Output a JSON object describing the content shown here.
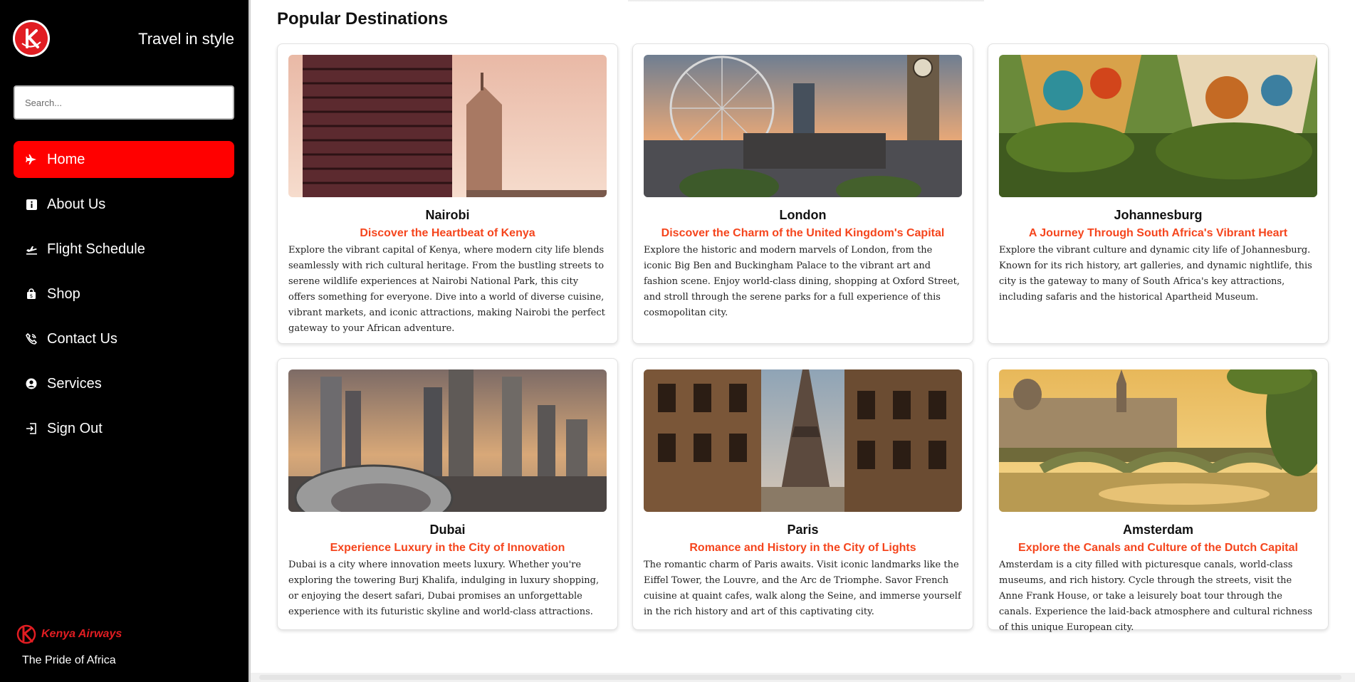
{
  "sidebar": {
    "tagline": "Travel in style",
    "search_placeholder": "Search...",
    "items": [
      {
        "label": "Home",
        "icon": "airplane-icon",
        "active": true
      },
      {
        "label": "About Us",
        "icon": "info-icon"
      },
      {
        "label": "Flight Schedule",
        "icon": "flight-departure-icon"
      },
      {
        "label": "Shop",
        "icon": "shopping-bag-icon"
      },
      {
        "label": "Contact Us",
        "icon": "phone-icon"
      },
      {
        "label": "Services",
        "icon": "user-circle-icon"
      },
      {
        "label": "Sign Out",
        "icon": "sign-out-icon"
      }
    ],
    "brand_name": "Kenya Airways",
    "motto": "The Pride of Africa"
  },
  "main": {
    "title": "Popular Destinations",
    "destinations": [
      {
        "city": "Nairobi",
        "subtitle": "Discover the Heartbeat of Kenya",
        "description": "Explore the vibrant capital of Kenya, where modern city life blends seamlessly with rich cultural heritage. From the bustling streets to serene wildlife experiences at Nairobi National Park, this city offers something for everyone. Dive into a world of diverse cuisine, vibrant markets, and iconic attractions, making Nairobi the perfect gateway to your African adventure."
      },
      {
        "city": "London",
        "subtitle": "Discover the Charm of the United Kingdom's Capital",
        "description": "Explore the historic and modern marvels of London, from the iconic Big Ben and Buckingham Palace to the vibrant art and fashion scene. Enjoy world-class dining, shopping at Oxford Street, and stroll through the serene parks for a full experience of this cosmopolitan city."
      },
      {
        "city": "Johannesburg",
        "subtitle": "A Journey Through South Africa's Vibrant Heart",
        "description": "Explore the vibrant culture and dynamic city life of Johannesburg. Known for its rich history, art galleries, and dynamic nightlife, this city is the gateway to many of South Africa's key attractions, including safaris and the historical Apartheid Museum."
      },
      {
        "city": "Dubai",
        "subtitle": "Experience Luxury in the City of Innovation",
        "description": "Dubai is a city where innovation meets luxury. Whether you're exploring the towering Burj Khalifa, indulging in luxury shopping, or enjoying the desert safari, Dubai promises an unforgettable experience with its futuristic skyline and world-class attractions."
      },
      {
        "city": "Paris",
        "subtitle": "Romance and History in the City of Lights",
        "description": "The romantic charm of Paris awaits. Visit iconic landmarks like the Eiffel Tower, the Louvre, and the Arc de Triomphe. Savor French cuisine at quaint cafes, walk along the Seine, and immerse yourself in the rich history and art of this captivating city."
      },
      {
        "city": "Amsterdam",
        "subtitle": "Explore the Canals and Culture of the Dutch Capital",
        "description": "Amsterdam is a city filled with picturesque canals, world-class museums, and rich history. Cycle through the streets, visit the Anne Frank House, or take a leisurely boat tour through the canals. Experience the laid-back atmosphere and cultural richness of this unique European city."
      }
    ]
  },
  "colors": {
    "accent": "#ff0000",
    "subtitle": "#f5451d",
    "sidebar_bg": "#000000",
    "brand_red": "#e11d22"
  }
}
